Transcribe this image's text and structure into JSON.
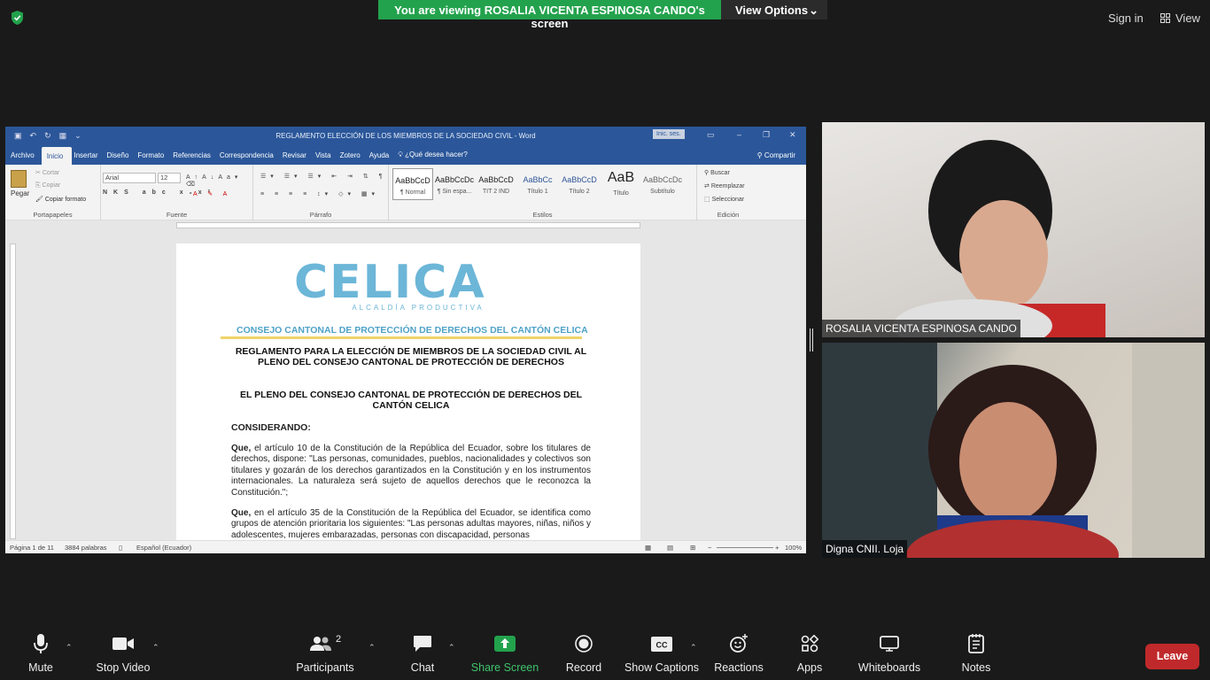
{
  "banner": {
    "message": "You are viewing ROSALIA VICENTA ESPINOSA CANDO's screen",
    "view_options": "View Options"
  },
  "top_right": {
    "sign_in": "Sign in",
    "view": "View"
  },
  "word": {
    "window_title": "REGLAMENTO ELECCIÓN DE LOS MIEMBROS DE LA SOCIEDAD CIVIL  -  Word",
    "inic_ses": "Inic. ses.",
    "tabs": [
      "Archivo",
      "Inicio",
      "Insertar",
      "Diseño",
      "Formato",
      "Referencias",
      "Correspondencia",
      "Revisar",
      "Vista",
      "Zotero",
      "Ayuda"
    ],
    "tell_me": "¿Qué desea hacer?",
    "share": "Compartir",
    "clipboard": {
      "paste": "Pegar",
      "cut": "Cortar",
      "copy": "Copiar",
      "format_painter": "Copiar formato",
      "label": "Portapapeles"
    },
    "font": {
      "name": "Arial",
      "size": "12",
      "label": "Fuente"
    },
    "paragraph_label": "Párrafo",
    "styles": [
      {
        "preview": "AaBbCcD",
        "name": "¶ Normal"
      },
      {
        "preview": "AaBbCcDc",
        "name": "¶ Sin espa..."
      },
      {
        "preview": "AaBbCcD",
        "name": "TIT 2 IND"
      },
      {
        "preview": "AaBbCc",
        "name": "Título 1"
      },
      {
        "preview": "AaBbCcD",
        "name": "Título 2"
      },
      {
        "preview": "AaB",
        "name": "Título"
      },
      {
        "preview": "AaBbCcDc",
        "name": "Subtítulo"
      }
    ],
    "styles_label": "Estilos",
    "editing": {
      "find": "Buscar",
      "replace": "Reemplazar",
      "select": "Seleccionar",
      "label": "Edición"
    },
    "document": {
      "logo_text": "CELICA",
      "logo_sub": "ALCALDÍA PRODUCTIVA",
      "council": "CONSEJO CANTONAL DE PROTECCIÓN DE DERECHOS  DEL CANTÓN CELICA",
      "title1": "REGLAMENTO PARA LA ELECCIÓN DE MIEMBROS DE LA SOCIEDAD CIVIL AL PLENO DEL CONSEJO CANTONAL DE PROTECCIÓN DE DERECHOS",
      "title2": "EL PLENO DEL CONSEJO CANTONAL DE PROTECCIÓN DE DERECHOS DEL CANTÓN CELICA",
      "considerando": "CONSIDERANDO:",
      "que": "Que,",
      "para1": " el artículo 10 de la Constitución de la República del Ecuador, sobre los titulares de derechos, dispone: \"Las personas, comunidades, pueblos, nacionalidades y colectivos son titulares y gozarán de los derechos garantizados en la Constitución y en los instrumentos internacionales. La naturaleza será sujeto de aquellos derechos que le reconozca la Constitución.\";",
      "para2": " en el artículo 35 de la Constitución de la República del Ecuador, se identifica como grupos de atención prioritaria los siguientes: \"Las personas adultas mayores, niñas, niños y adolescentes, mujeres embarazadas, personas con discapacidad, personas"
    },
    "status": {
      "page": "Página 1 de 11",
      "words": "3884 palabras",
      "language": "Español (Ecuador)",
      "zoom": "100%"
    }
  },
  "participants": [
    {
      "name": "ROSALIA VICENTA ESPINOSA CANDO"
    },
    {
      "name": "Digna CNII. Loja"
    }
  ],
  "toolbar": {
    "mute": "Mute",
    "stop_video": "Stop Video",
    "participants": "Participants",
    "participants_count": "2",
    "chat": "Chat",
    "share_screen": "Share Screen",
    "record": "Record",
    "show_captions": "Show Captions",
    "reactions": "Reactions",
    "apps": "Apps",
    "whiteboards": "Whiteboards",
    "notes": "Notes",
    "leave": "Leave"
  },
  "colors": {
    "share_green": "#23a24d",
    "leave_red": "#c0292b",
    "word_blue": "#2b579a"
  }
}
